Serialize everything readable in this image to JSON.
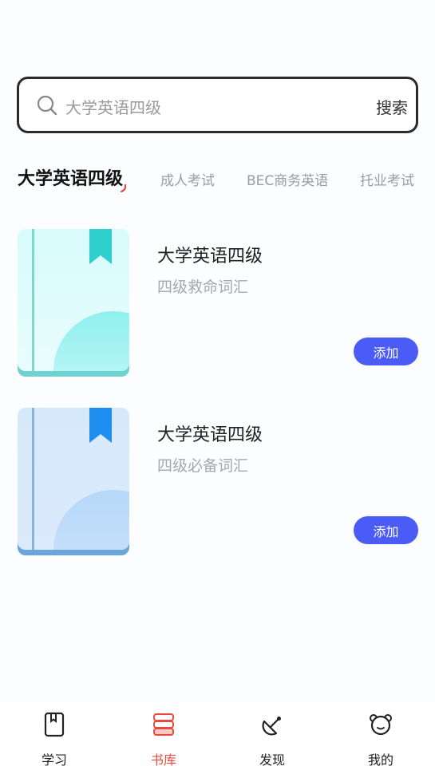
{
  "search": {
    "placeholder": "大学英语四级",
    "button_label": "搜索"
  },
  "category_tabs": [
    {
      "label": "大学英语四级",
      "active": true
    },
    {
      "label": "成人考试",
      "active": false
    },
    {
      "label": "BEC商务英语",
      "active": false
    },
    {
      "label": "托业考试",
      "active": false
    }
  ],
  "books": [
    {
      "title": "大学英语四级",
      "subtitle": "四级救命词汇",
      "add_label": "添加",
      "cover_color": "teal"
    },
    {
      "title": "大学英语四级",
      "subtitle": "四级必备词汇",
      "add_label": "添加",
      "cover_color": "blue"
    }
  ],
  "tabbar": [
    {
      "label": "学习",
      "icon": "book-icon",
      "active": false
    },
    {
      "label": "书库",
      "icon": "library-icon",
      "active": true
    },
    {
      "label": "发现",
      "icon": "satellite-icon",
      "active": false
    },
    {
      "label": "我的",
      "icon": "bear-face-icon",
      "active": false
    }
  ],
  "colors": {
    "accent": "#4a5cf5",
    "active_tab": "#e84a3c"
  }
}
